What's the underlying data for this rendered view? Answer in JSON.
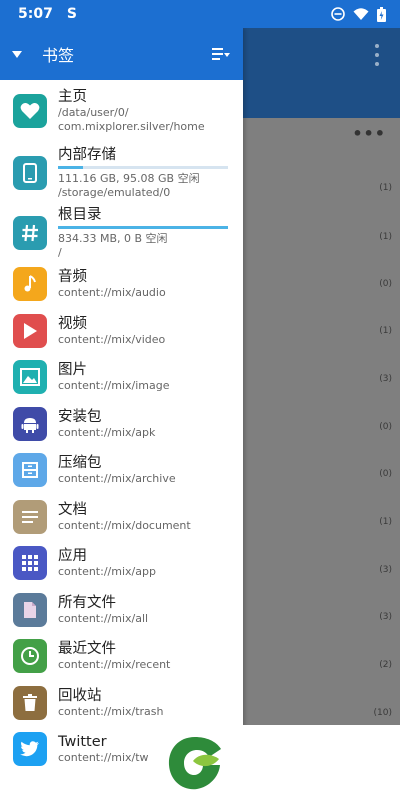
{
  "status": {
    "time": "5:07",
    "app_glyph": "S"
  },
  "drawer": {
    "title": "书签",
    "items": [
      {
        "name": "主页",
        "path": "/data/user/0/",
        "path2": "com.mixplorer.silver/home",
        "color": "#1ba39c",
        "icon": "heart-icon"
      },
      {
        "name": "内部存储",
        "detail": "111.16 GB, 95.08 GB 空闲",
        "path": "/storage/emulated/0",
        "usage": 0.145,
        "color": "#2a9cb0",
        "icon": "phone-icon"
      },
      {
        "name": "根目录",
        "detail": "834.33 MB, 0 B 空闲",
        "path": "/",
        "usage": 1.0,
        "color": "#2a9cb0",
        "icon": "hash-icon"
      },
      {
        "name": "音频",
        "path": "content://mix/audio",
        "color": "#f4a71c",
        "icon": "music-icon"
      },
      {
        "name": "视频",
        "path": "content://mix/video",
        "color": "#e04e4e",
        "icon": "play-icon"
      },
      {
        "name": "图片",
        "path": "content://mix/image",
        "color": "#1fb0b0",
        "icon": "image-icon"
      },
      {
        "name": "安装包",
        "path": "content://mix/apk",
        "color": "#3f4ba8",
        "icon": "android-icon"
      },
      {
        "name": "压缩包",
        "path": "content://mix/archive",
        "color": "#5ea8e8",
        "icon": "archive-icon"
      },
      {
        "name": "文档",
        "path": "content://mix/document",
        "color": "#b19c78",
        "icon": "document-icon"
      },
      {
        "name": "应用",
        "path": "content://mix/app",
        "color": "#4a58c4",
        "icon": "grid-icon"
      },
      {
        "name": "所有文件",
        "path": "content://mix/all",
        "color": "#5b7b9a",
        "icon": "file-icon"
      },
      {
        "name": "最近文件",
        "path": "content://mix/recent",
        "color": "#43a047",
        "icon": "clock-icon"
      },
      {
        "name": "回收站",
        "path": "content://mix/trash",
        "color": "#8d6e3f",
        "icon": "trash-icon"
      },
      {
        "name": "Twitter",
        "path": "content://mix/tw",
        "color": "#1da1f2",
        "icon": "twitter-icon"
      }
    ]
  },
  "background": {
    "more": "•••",
    "counts": [
      "(1)",
      "(1)",
      "(0)",
      "(1)",
      "(3)",
      "(0)",
      "(0)",
      "(1)",
      "(3)",
      "(3)",
      "(2)",
      "(10)"
    ]
  },
  "colors": {
    "primary": "#1c6fd1",
    "toolbar_dark": "#1e4f86",
    "scrim": "#7f7f7f",
    "storage_bar": "#4bb3e6",
    "logo_green": "#2e8b3a"
  }
}
